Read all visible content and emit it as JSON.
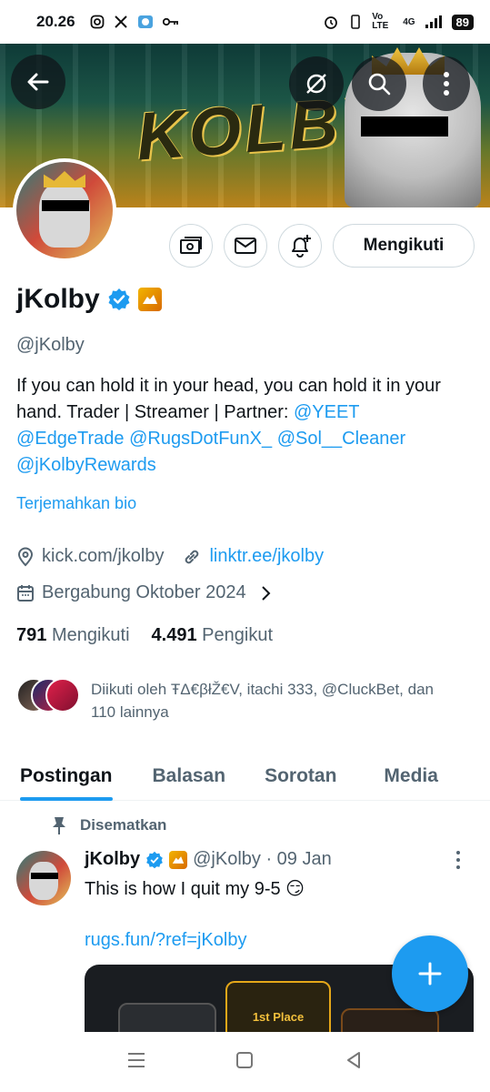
{
  "status_bar": {
    "time": "20.26",
    "network": "4G",
    "volte": "Vo LTE",
    "battery": "89"
  },
  "banner": {
    "title_text": "KOLBY"
  },
  "profile": {
    "name": "jKolby",
    "handle": "@jKolby",
    "bio_text": "If you can hold it in your head, you can hold it in your hand.  Trader | Streamer | Partner: ",
    "bio_links": [
      "@YEET",
      "@EdgeTrade",
      "@RugsDotFunX_",
      "@Sol__Cleaner",
      "@jKolbyRewards"
    ],
    "translate_label": "Terjemahkan bio",
    "website": "kick.com/jkolby",
    "link2": "linktr.ee/jkolby",
    "joined": "Bergabung Oktober 2024",
    "following_count": "791",
    "following_label": "Mengikuti",
    "followers_count": "4.491",
    "followers_label": "Pengikut",
    "followed_by": "Diikuti oleh ŦΔ€βłŽ€V, itachi 333, @CluckBet, dan 110 lainnya",
    "follow_button": "Mengikuti"
  },
  "tabs": [
    {
      "label": "Postingan",
      "active": true
    },
    {
      "label": "Balasan",
      "active": false
    },
    {
      "label": "Sorotan",
      "active": false
    },
    {
      "label": "Media",
      "active": false
    }
  ],
  "pinned_post": {
    "pinned_label": "Disematkan",
    "author": "jKolby",
    "meta": "@jKolby · 09 Jan",
    "text": "This is how I quit my 9-5 😏",
    "link": "rugs.fun/?ref=jKolby",
    "media_card_label": "1st Place"
  },
  "colors": {
    "accent": "#1d9bf0",
    "text": "#0f1419",
    "secondary": "#536471"
  }
}
